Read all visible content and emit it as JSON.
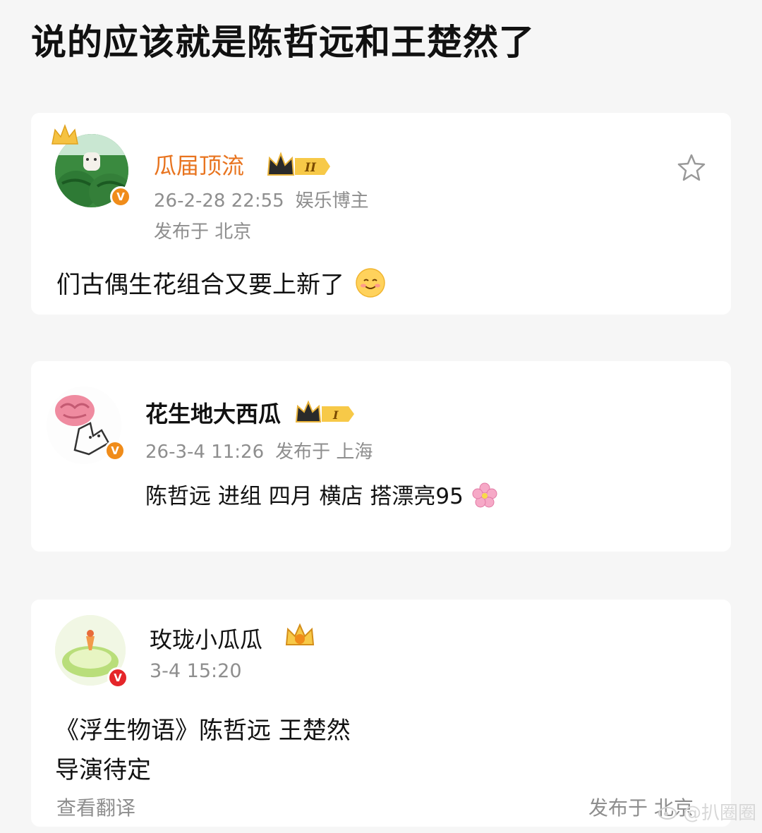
{
  "title": "说的应该就是陈哲远和王楚然了",
  "posts": [
    {
      "username": "瓜届顶流",
      "level_badge": "II",
      "time": "26-2-28 22:55",
      "tag": "娱乐博主",
      "location": "发布于 北京",
      "content": "们古偶生花组合又要上新了",
      "emoji": "smiling-face-emoji",
      "verified": "V"
    },
    {
      "username": "花生地大西瓜",
      "level_badge": "I",
      "time": "26-3-4 11:26",
      "location": "发布于 上海",
      "content": "陈哲远 进组 四月 横店 搭漂亮95",
      "emoji": "cherry-blossom-emoji",
      "verified": "V"
    },
    {
      "username": "玫珑小瓜瓜",
      "time": "3-4 15:20",
      "content_line1": "《浮生物语》陈哲远 王楚然",
      "content_line2": "导演待定",
      "translate": "查看翻译",
      "location": "发布于 北京",
      "verified": "V"
    }
  ],
  "watermark": "@扒圈圈",
  "colors": {
    "orange_name": "#e8741f",
    "meta_gray": "#8e8e8e",
    "verified_orange": "#f08c1a",
    "verified_red": "#e5262a",
    "badge_gold": "#f5c242"
  }
}
